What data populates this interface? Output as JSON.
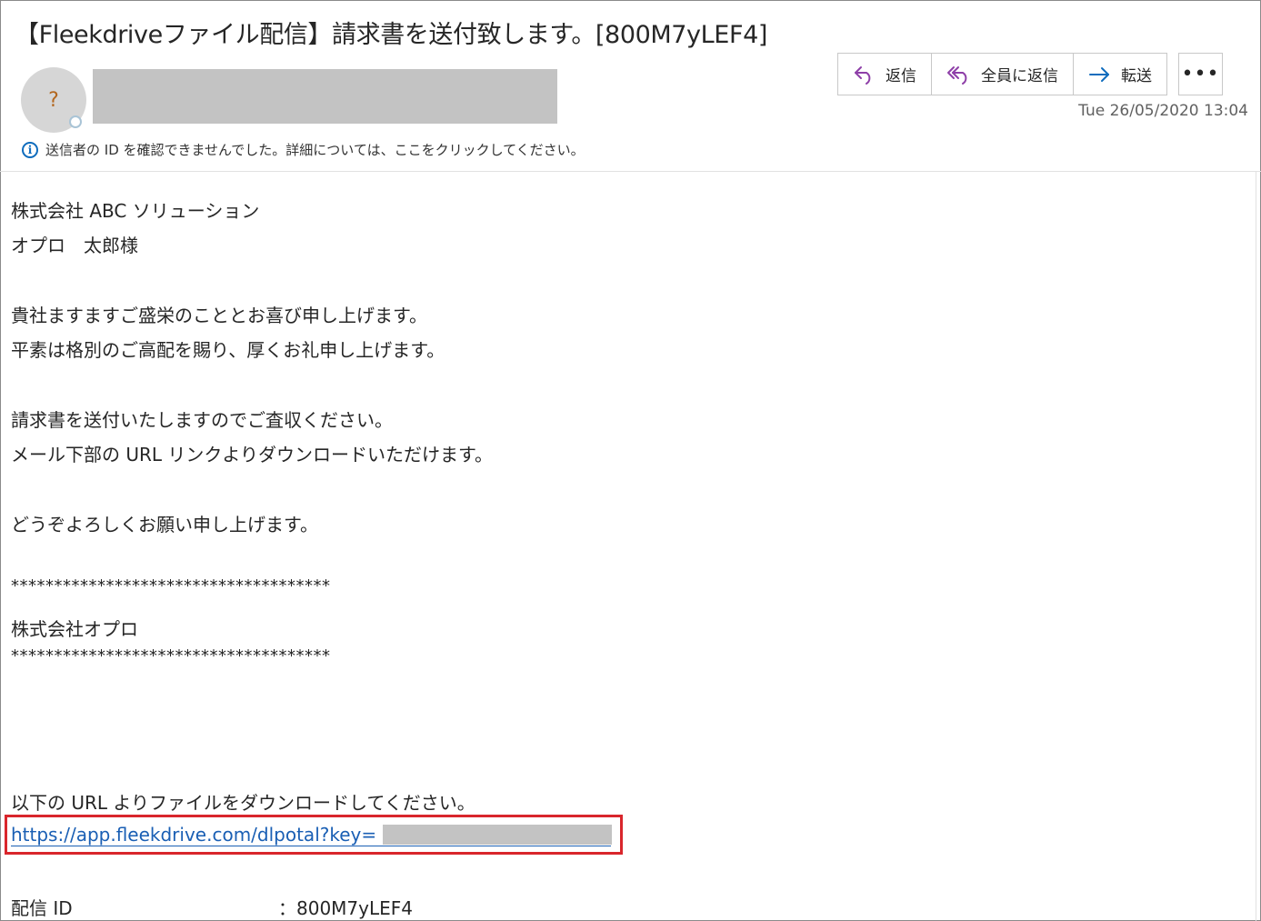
{
  "subject": "【Fleekdriveファイル配信】請求書を送付致します。[800M7yLEF4]",
  "sender": {
    "avatar_initial": "?"
  },
  "actions": {
    "reply_label": "返信",
    "reply_all_label": "全員に返信",
    "forward_label": "転送",
    "more_label": "•••"
  },
  "datetime": "Tue 26/05/2020 13:04",
  "info_banner": "送信者の ID を確認できませんでした。詳細については、ここをクリックしてください。",
  "body": {
    "lines": [
      "株式会社 ABC ソリューション",
      "オプロ　太郎様",
      "貴社ますますご盛栄のこととお喜び申し上げます。",
      "平素は格別のご高配を賜り、厚くお礼申し上げます。",
      "請求書を送付いたしますのでご査収ください。",
      "メール下部の URL リンクよりダウンロードいただけます。",
      "どうぞよろしくお願い申し上げます。",
      "*************************************",
      "株式会社オプロ",
      "*************************************",
      "以下の URL よりファイルをダウンロードしてください。"
    ],
    "link_text": "https://app.fleekdrive.com/dlpotal?key=",
    "delivery_id_label": "配信 ID",
    "delivery_id_value": "：800M7yLEF4"
  },
  "colors": {
    "accent_purple": "#8e3fa8",
    "accent_blue": "#0f6cbd",
    "highlight_red": "#d9262c"
  }
}
